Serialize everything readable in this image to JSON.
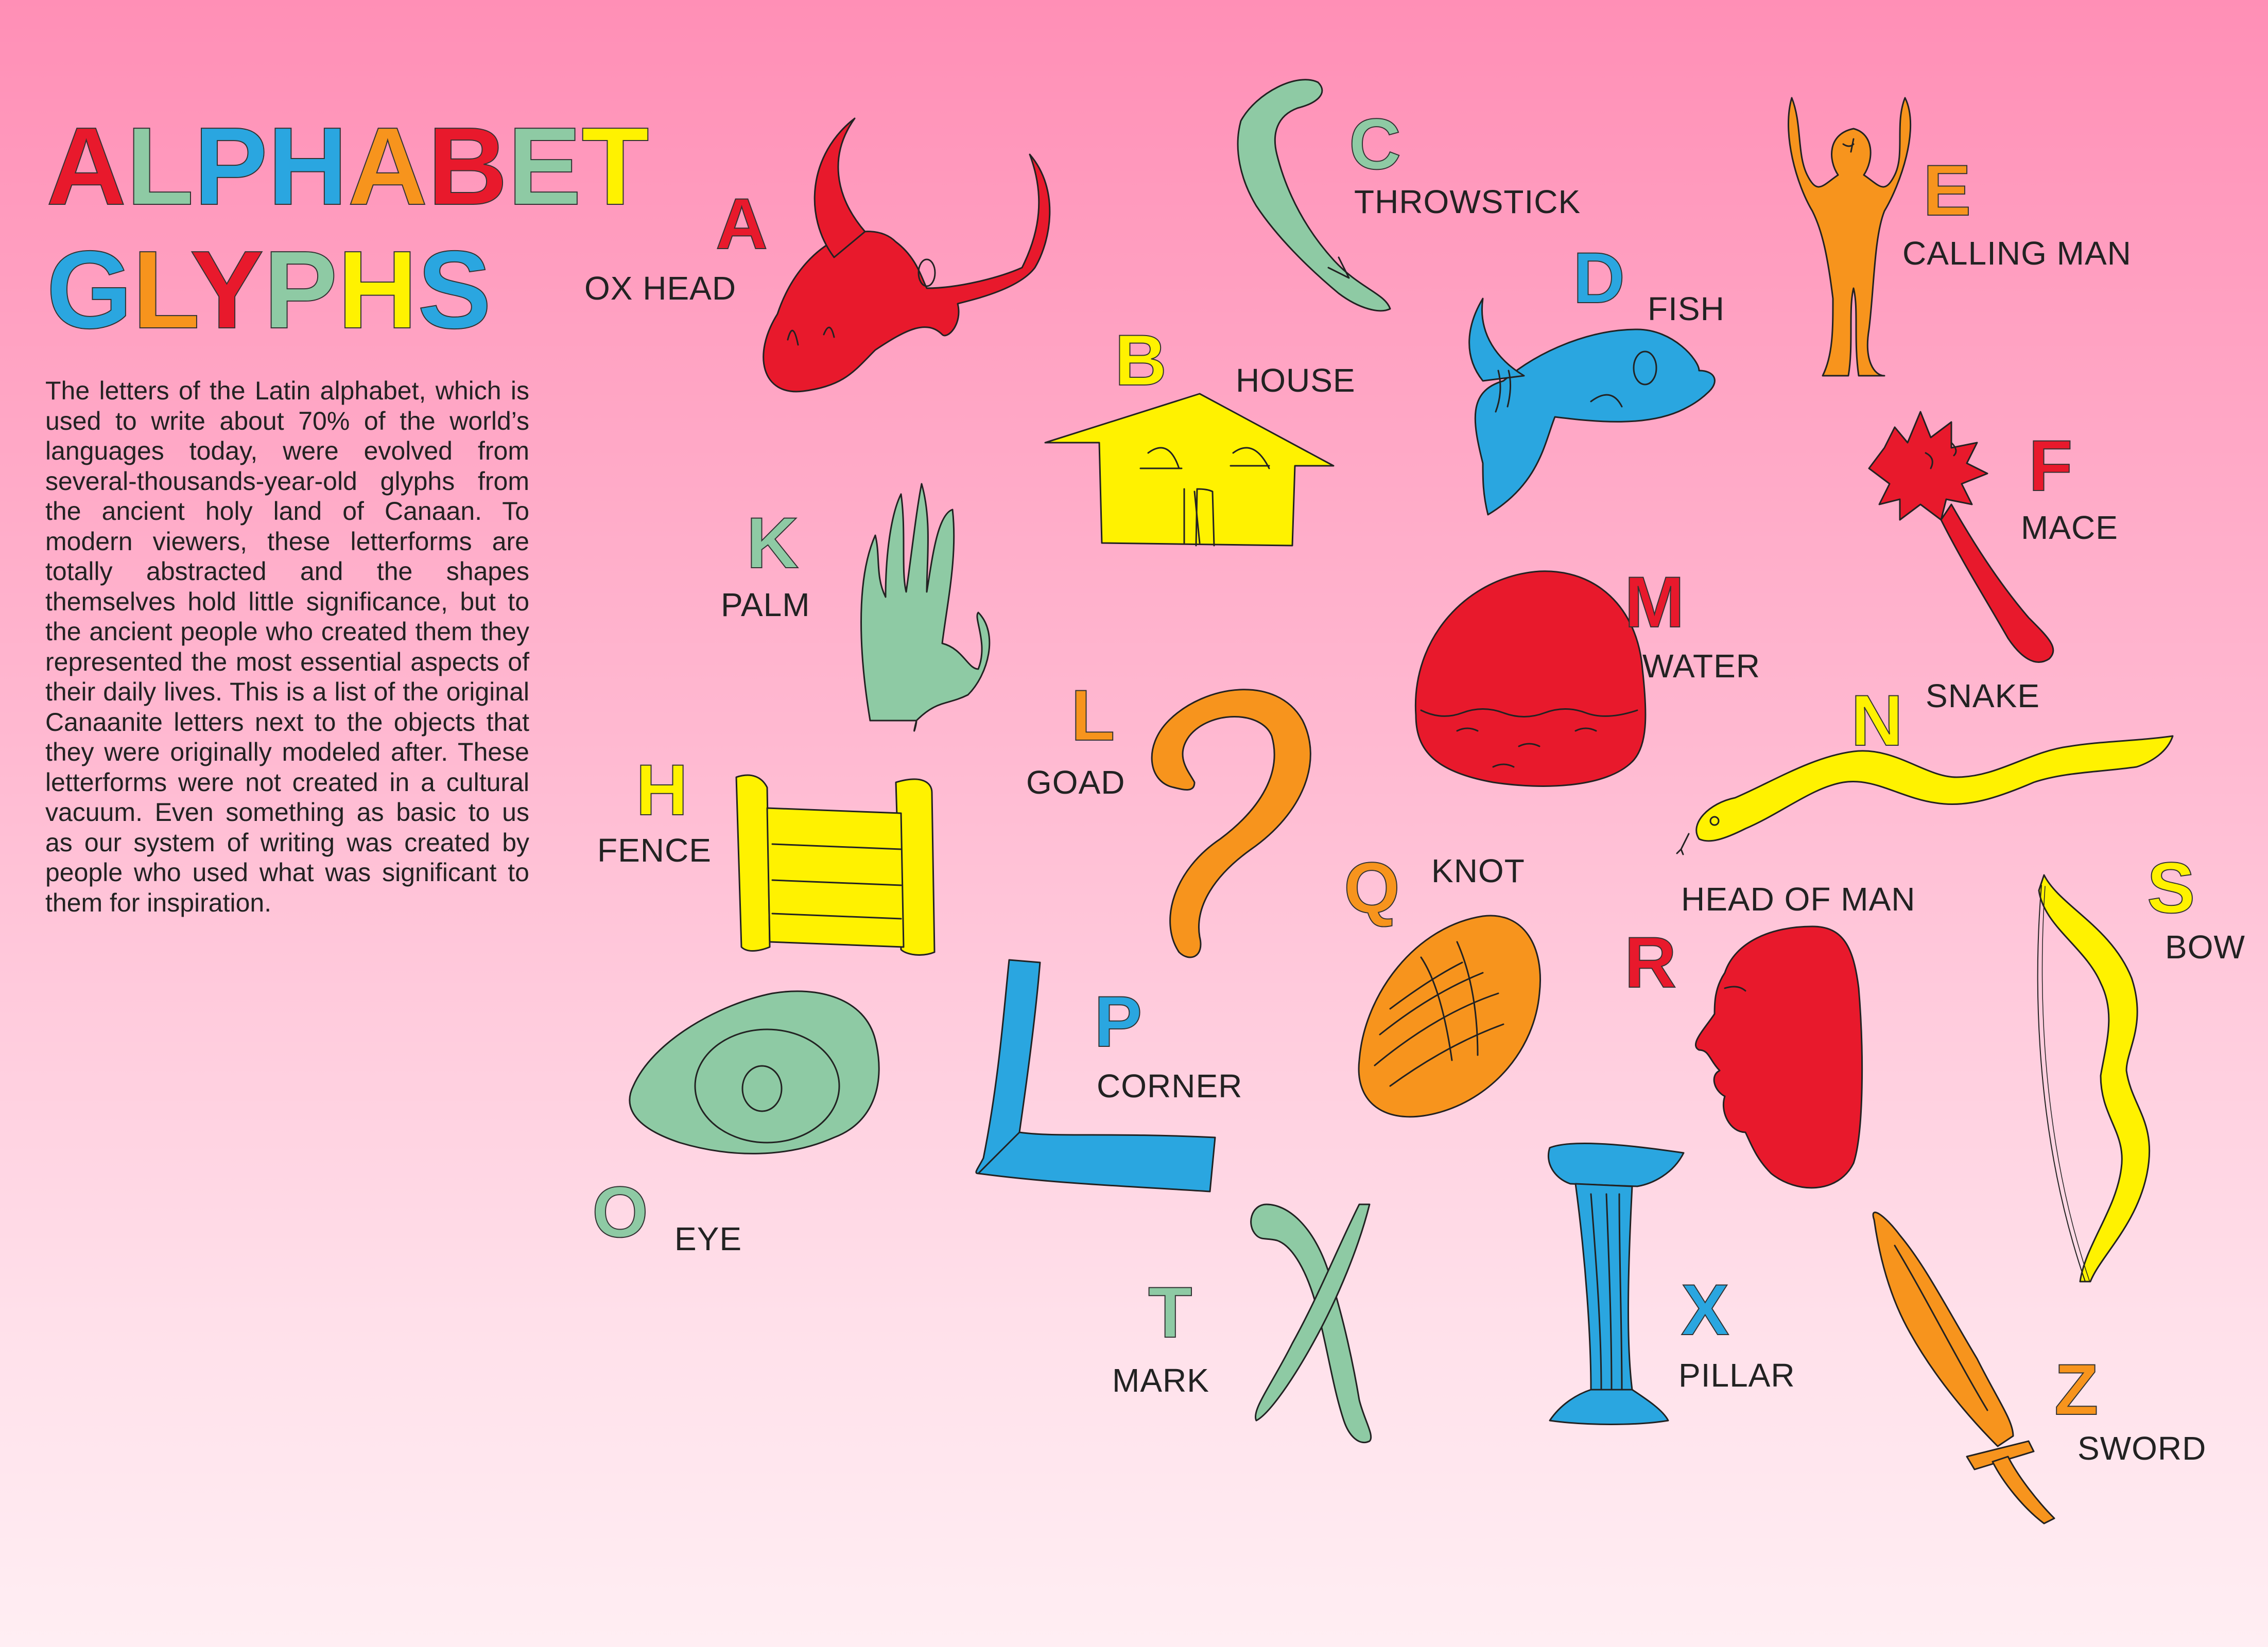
{
  "title": {
    "line1": [
      {
        "ch": "A",
        "color": "#e8192c"
      },
      {
        "ch": "L",
        "color": "#8ecaa4"
      },
      {
        "ch": "P",
        "color": "#2aa6e0"
      },
      {
        "ch": "H",
        "color": "#2aa6e0"
      },
      {
        "ch": "A",
        "color": "#f7941d"
      },
      {
        "ch": "B",
        "color": "#e8192c"
      },
      {
        "ch": "E",
        "color": "#8ecaa4"
      },
      {
        "ch": "T",
        "color": "#fff200"
      }
    ],
    "line2": [
      {
        "ch": "G",
        "color": "#2aa6e0"
      },
      {
        "ch": "L",
        "color": "#f7941d"
      },
      {
        "ch": "Y",
        "color": "#e8192c"
      },
      {
        "ch": "P",
        "color": "#8ecaa4"
      },
      {
        "ch": "H",
        "color": "#fff200"
      },
      {
        "ch": "S",
        "color": "#2aa6e0"
      }
    ]
  },
  "intro_text": "The letters of the Latin alphabet, which is used to write about 70% of the world’s languages today, were evolved from several-thousands-year-old glyphs from the ancient holy land of Canaan. To modern viewers, these letterforms are totally abstracted and the shapes themselves hold little significance, but to the ancient people who created them they represented the most essential aspects of their daily lives. This is a list of the original Canaanite letters next to the objects that they were originally modeled after. These letterforms were not created in a cultural vacuum. Even something as basic to us as our system of writing was created by people who used what was significant to them for inspiration.",
  "glyphs": {
    "A": {
      "letter": "A",
      "word": "OX HEAD",
      "color": "#e8192c",
      "icon": "ox-head-icon"
    },
    "B": {
      "letter": "B",
      "word": "HOUSE",
      "color": "#fff200",
      "icon": "house-icon"
    },
    "C": {
      "letter": "C",
      "word": "THROWSTICK",
      "color": "#8ecaa4",
      "icon": "throwstick-icon"
    },
    "D": {
      "letter": "D",
      "word": "FISH",
      "color": "#2aa6e0",
      "icon": "fish-icon"
    },
    "E": {
      "letter": "E",
      "word": "CALLING MAN",
      "color": "#f7941d",
      "icon": "calling-man-icon"
    },
    "F": {
      "letter": "F",
      "word": "MACE",
      "color": "#e8192c",
      "icon": "mace-icon"
    },
    "H": {
      "letter": "H",
      "word": "FENCE",
      "color": "#fff200",
      "icon": "fence-icon"
    },
    "K": {
      "letter": "K",
      "word": "PALM",
      "color": "#8ecaa4",
      "icon": "palm-icon"
    },
    "L": {
      "letter": "L",
      "word": "GOAD",
      "color": "#f7941d",
      "icon": "goad-icon"
    },
    "M": {
      "letter": "M",
      "word": "WATER",
      "color": "#e8192c",
      "icon": "water-icon"
    },
    "N": {
      "letter": "N",
      "word": "SNAKE",
      "color": "#fff200",
      "icon": "snake-icon"
    },
    "O": {
      "letter": "O",
      "word": "EYE",
      "color": "#8ecaa4",
      "icon": "eye-icon"
    },
    "P": {
      "letter": "P",
      "word": "CORNER",
      "color": "#2aa6e0",
      "icon": "corner-icon"
    },
    "Q": {
      "letter": "Q",
      "word": "KNOT",
      "color": "#f7941d",
      "icon": "knot-icon"
    },
    "R": {
      "letter": "R",
      "word": "HEAD OF MAN",
      "color": "#e8192c",
      "icon": "head-of-man-icon"
    },
    "S": {
      "letter": "S",
      "word": "BOW",
      "color": "#fff200",
      "icon": "bow-icon"
    },
    "T": {
      "letter": "T",
      "word": "MARK",
      "color": "#8ecaa4",
      "icon": "mark-icon"
    },
    "X": {
      "letter": "X",
      "word": "PILLAR",
      "color": "#2aa6e0",
      "icon": "pillar-icon"
    },
    "Z": {
      "letter": "Z",
      "word": "SWORD",
      "color": "#f7941d",
      "icon": "sword-icon"
    }
  }
}
